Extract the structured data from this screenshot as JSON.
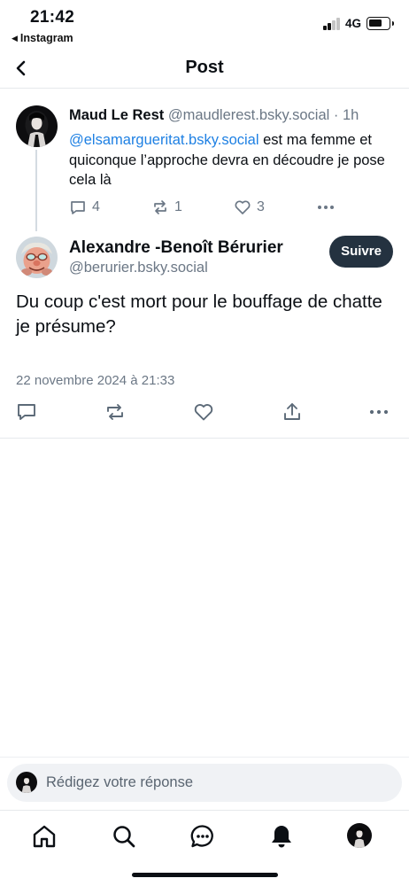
{
  "status_bar": {
    "time": "21:42",
    "back_app": "Instagram",
    "network": "4G"
  },
  "header": {
    "title": "Post",
    "back_icon": "chevron-left-icon"
  },
  "parent_post": {
    "author_name": "Maud Le Rest",
    "handle": "@maudlerest.bsky.social",
    "separator": "·",
    "time_ago": "1h",
    "mention": "@elsamargueritat.bsky.social",
    "text_after_mention": " est ma femme et quiconque l’approche devra en découdre je pose cela là",
    "reply_count": "4",
    "repost_count": "1",
    "like_count": "3"
  },
  "main_post": {
    "author_name": "Alexandre -Benoît Bérurier",
    "handle": "@berurier.bsky.social",
    "follow_label": "Suivre",
    "text": "Du coup c'est mort pour le bouffage de chatte je présume?",
    "timestamp": "22 novembre 2024 à 21:33"
  },
  "reply_bar": {
    "placeholder": "Rédigez votre réponse"
  },
  "tab_bar": {
    "items": [
      "home-icon",
      "search-icon",
      "chat-icon",
      "bell-icon",
      "profile-avatar"
    ]
  },
  "colors": {
    "accent": "#1e80e3",
    "secondary_text": "#6b7785",
    "follow_button": "#243240"
  }
}
